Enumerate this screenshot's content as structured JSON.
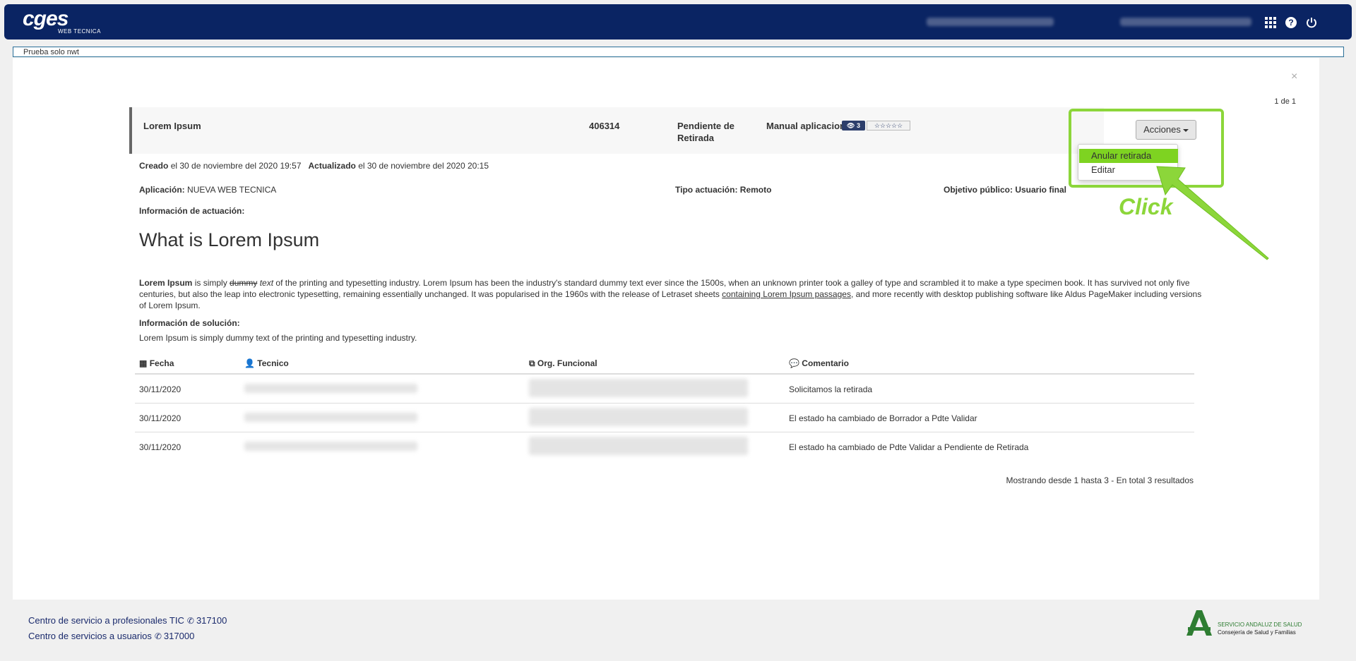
{
  "header": {
    "logo_main": "cges",
    "logo_sub": "WEB TECNICA"
  },
  "notice": "Prueba solo nwt",
  "panel": {
    "close": "×",
    "page_count": "1 de 1",
    "ticket": {
      "title": "Lorem Ipsum",
      "id": "406314",
      "status": "Pendiente de Retirada",
      "type": "Manual aplicacion",
      "views": "3",
      "stars": "☆☆☆☆☆"
    },
    "actions": {
      "button_label": "Acciones",
      "items": [
        "Anular retirada",
        "Editar"
      ],
      "annotation": "Click"
    },
    "meta": {
      "created_label": "Creado",
      "created_value": "el 30 de noviembre del 2020 19:57",
      "updated_label": "Actualizado",
      "updated_value": "el 30 de noviembre del 2020 20:15",
      "app_label": "Aplicación:",
      "app_value": "NUEVA WEB TECNICA",
      "tipo_label": "Tipo actuación: Remoto",
      "objetivo_label": "Objetivo público: Usuario final",
      "info_actuacion_label": "Información de actuación:"
    },
    "content": {
      "heading": "What is Lorem Ipsum",
      "para_bold": "Lorem Ipsum",
      "para_1": " is simply ",
      "para_strike": "dummy",
      "para_italic": " text",
      "para_2": " of the printing and typesetting industry. Lorem Ipsum has been the industry's standard dummy text ever since the 1500s, when an unknown printer took a galley of type and scrambled it to make a type specimen book. It has survived not only five centuries, but also the leap into electronic typesetting, remaining essentially unchanged. It was popularised in the 1960s with the release of Letraset sheets ",
      "para_link": "containing Lorem Ipsum passages",
      "para_3": ", and more recently with desktop publishing software like Aldus PageMaker including versions of Lorem Ipsum.",
      "solution_label": "Información de solución:",
      "solution_text": "Lorem Ipsum is simply dummy text of the printing and typesetting industry."
    },
    "table": {
      "headers": [
        "Fecha",
        "Tecnico",
        "Org. Funcional",
        "Comentario"
      ],
      "rows": [
        {
          "fecha": "30/11/2020",
          "comentario": "Solicitamos la retirada"
        },
        {
          "fecha": "30/11/2020",
          "comentario": "El estado ha cambiado de Borrador a Pdte Validar"
        },
        {
          "fecha": "30/11/2020",
          "comentario": "El estado ha cambiado de Pdte Validar a Pendiente de Retirada"
        }
      ],
      "showing": "Mostrando desde 1 hasta 3 - En total 3 resultados"
    }
  },
  "footer": {
    "line1_label": "Centro de servicio a profesionales TIC",
    "line1_phone": "317100",
    "line2_label": "Centro de servicios a usuarios",
    "line2_phone": "317000",
    "sas_line1": "SERVICIO ANDALUZ DE SALUD",
    "sas_line2": "Consejería de Salud y Familias"
  },
  "colors": {
    "header_bg": "#0a2463",
    "highlight": "#8cd63a",
    "active_item": "#7ed321"
  }
}
